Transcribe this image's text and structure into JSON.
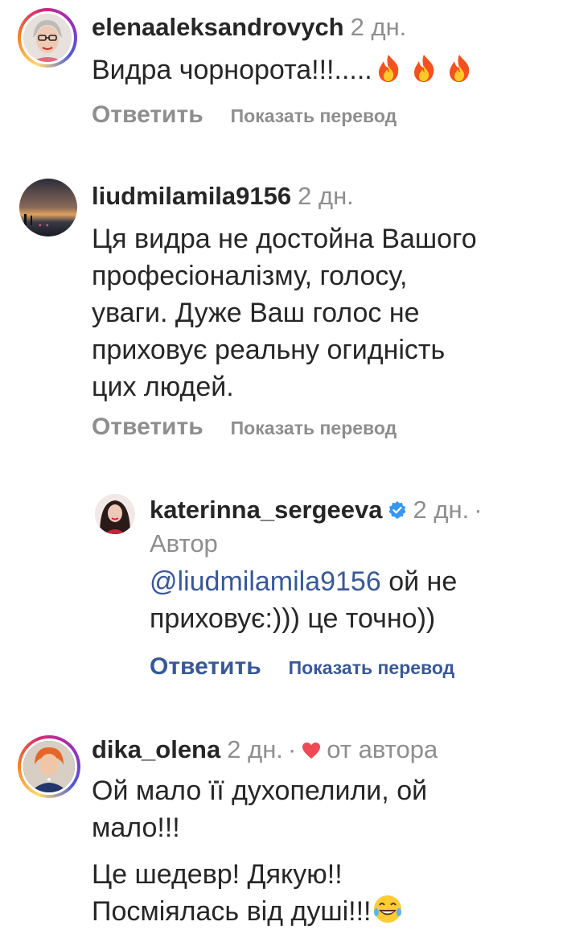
{
  "comments": [
    {
      "username": "elenaaleksandrovych",
      "time": "2 дн.",
      "text": "Видра чорнорота!!!.....",
      "emoji": "fire-icon",
      "reply_label": "Ответить",
      "translate_label": "Показать перевод"
    },
    {
      "username": "liudmilamila9156",
      "time": "2 дн.",
      "text_lines": [
        "Ця видра не достойна Вашого",
        "професіоналізму, голосу,",
        "уваги. Дуже Ваш голос не",
        "приховує реальну огидність",
        "цих людей."
      ],
      "reply_label": "Ответить",
      "translate_label": "Показать перевод"
    },
    {
      "username": "katerinna_sergeeva",
      "verified": true,
      "time": "2 дн.",
      "separator": "·",
      "author_badge": "Автор",
      "mention": "@liudmilamila9156",
      "text_rest": " ой не",
      "text_line2": "приховує:))) це точно))",
      "reply_label": "Ответить",
      "translate_label": "Показать перевод"
    },
    {
      "username": "dika_olena",
      "time": "2 дн.",
      "separator": "·",
      "liked_by_author": "от автора",
      "text_lines": [
        "Ой мало її духопелили, ой",
        "мало!!!"
      ],
      "text_lines2": [
        "Це шедевр! Дякую!!",
        "Посміялась від душі!!!"
      ],
      "emoji": "laughing-face-icon"
    }
  ],
  "colors": {
    "text": "#262626",
    "muted": "#8e8e8e",
    "link": "#385898",
    "verified": "#3897f0",
    "heart": "#ed4956"
  }
}
